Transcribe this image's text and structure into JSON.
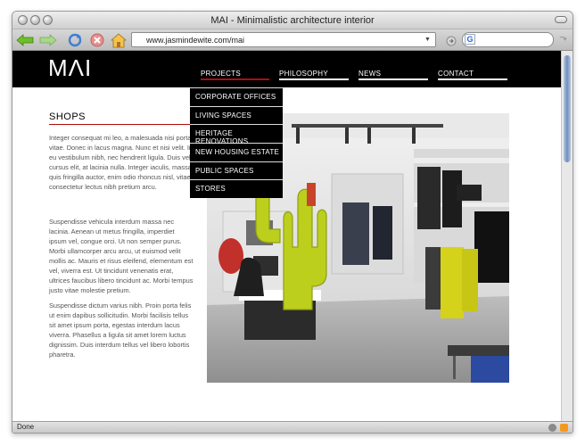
{
  "window": {
    "title": "MAI - Minimalistic architecture interior"
  },
  "toolbar": {
    "url": "www.jasmindewite.com/mai",
    "search_engine_letter": "G"
  },
  "site": {
    "logo": "MΛI",
    "nav": [
      {
        "label": "PROJECTS",
        "active": true
      },
      {
        "label": "PHILOSOPHY",
        "active": false
      },
      {
        "label": "NEWS",
        "active": false
      },
      {
        "label": "CONTACT",
        "active": false
      }
    ],
    "dropdown": [
      "CORPORATE OFFICES",
      "LIVING SPACES",
      "HERITAGE RENOVATIONS",
      "NEW HOUSING ESTATE",
      "PUBLIC SPACES",
      "STORES"
    ],
    "section_title": "SHOPS",
    "paragraphs": [
      "Integer consequat mi leo, a malesuada nisi porta vitae. Donec in lacus magna. Nunc et nisi velit. In eu vestibulum nibh, nec hendrerit ligula. Duis vel cursus elit, at lacinia nulla. Integer iaculis, massa quis fringilla auctor, enim odio rhoncus nisl, vitae consectetur lectus nibh pretium arcu.",
      "Suspendisse vehicula interdum massa nec lacinia. Aenean ut metus fringilla, imperdiet ipsum vel, congue orci. Ut non semper purus. Morbi ullamcorper arcu arcu, ut euismod velit mollis ac. Mauris et risus eleifend, elementum est vel, viverra est. Ut tincidunt venenatis erat, ultrices faucibus libero tincidunt ac. Morbi tempus justo vitae molestie pretium.",
      "Suspendisse dictum varius nibh. Proin porta felis ut enim dapibus sollicitudin. Morbi facilisis tellus sit amet ipsum porta, egestas interdum lacus viverra. Phasellus a ligula sit amet lorem luctus dignissim. Duis interdum tellus vel libero lobortis pharetra."
    ]
  },
  "status": {
    "text": "Done"
  },
  "colors": {
    "accent": "#b00d0d",
    "header_bg": "#000000",
    "nav_underline": "#ffffff",
    "cactus": "#bccf1d"
  }
}
